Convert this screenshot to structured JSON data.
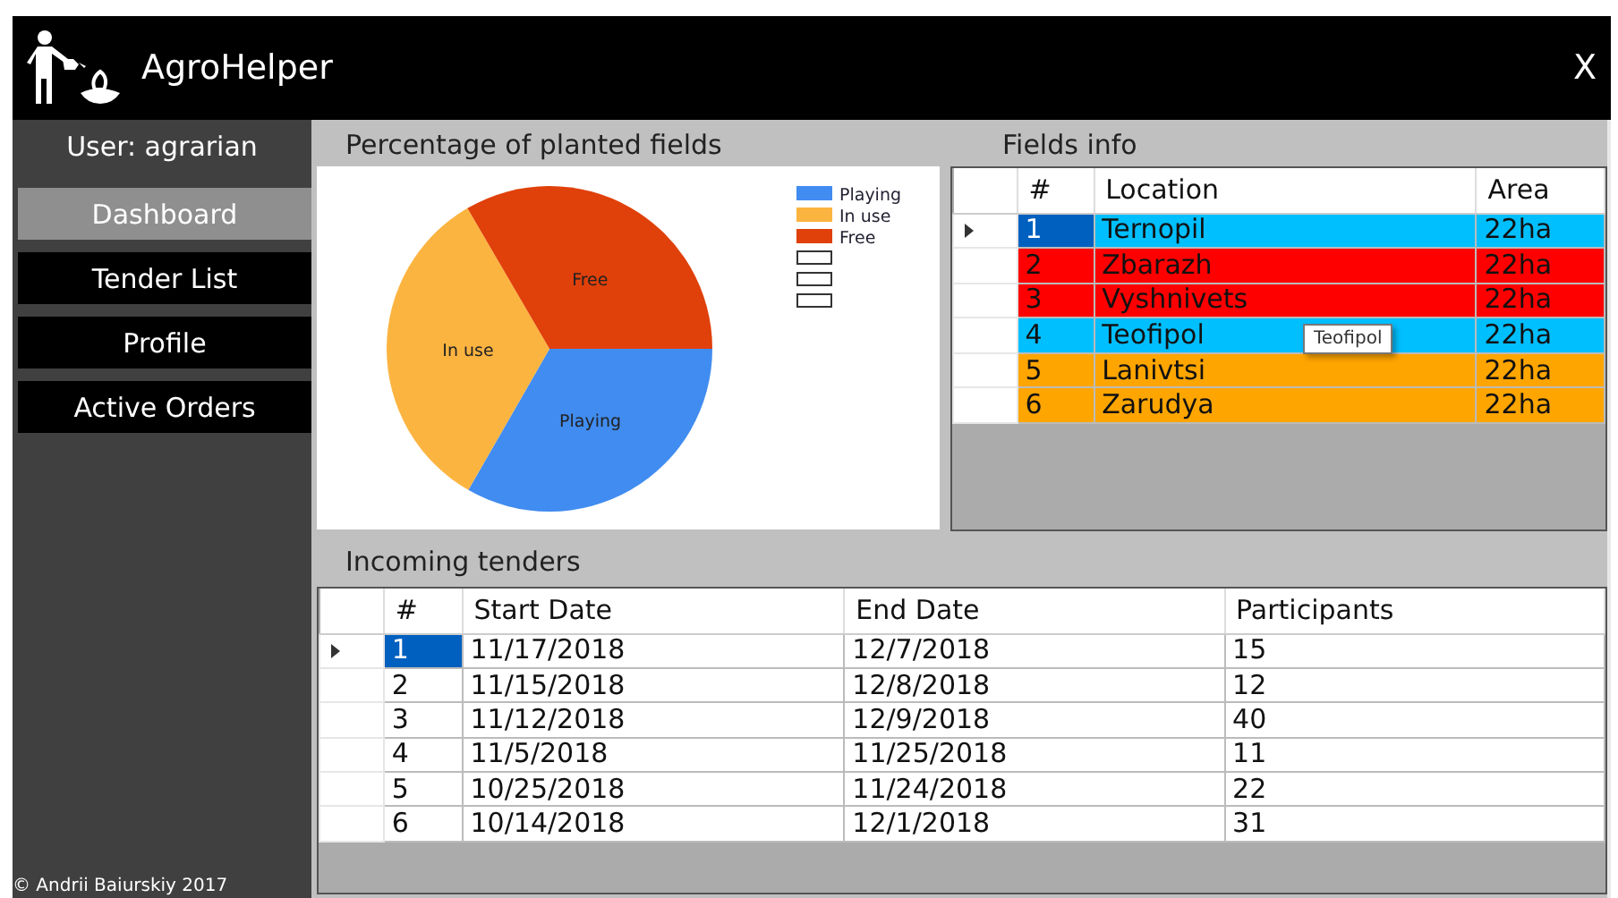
{
  "app": {
    "title": "AgroHelper",
    "close": "X"
  },
  "sidebar": {
    "user": "User: agrarian",
    "items": [
      {
        "label": "Dashboard",
        "selected": true
      },
      {
        "label": "Tender List",
        "selected": false
      },
      {
        "label": "Profile",
        "selected": false
      },
      {
        "label": "Active Orders",
        "selected": false
      }
    ],
    "footer": "© Andrii Baiurskiy 2017"
  },
  "planted_fields": {
    "title": "Percentage of planted fields",
    "chart_data": {
      "type": "pie",
      "categories": [
        "Playing",
        "In use",
        "Free"
      ],
      "values": [
        33.3,
        33.3,
        33.4
      ],
      "legend": "top-right",
      "colors": [
        "#418cf0",
        "#fcb441",
        "#e0400a"
      ]
    },
    "blank_legend_entries": [
      {
        "kind": "blank"
      },
      {
        "kind": "blank"
      },
      {
        "kind": "blank"
      }
    ]
  },
  "fields_info": {
    "title": "Fields info",
    "columns": [
      "#",
      "Location",
      "Area"
    ],
    "rows": [
      {
        "cells": [
          "1",
          "Ternopil",
          "22ha"
        ],
        "color": "#00bfff",
        "selected": true
      },
      {
        "cells": [
          "2",
          "Zbarazh",
          "22ha"
        ],
        "color": "#ff0000",
        "selected": false
      },
      {
        "cells": [
          "3",
          "Vyshnivets",
          "22ha"
        ],
        "color": "#ff0000",
        "selected": false
      },
      {
        "cells": [
          "4",
          "Teofipol",
          "22ha"
        ],
        "color": "#00bfff",
        "selected": false
      },
      {
        "cells": [
          "5",
          "Lanivtsi",
          "22ha"
        ],
        "color": "#ffa500",
        "selected": false
      },
      {
        "cells": [
          "6",
          "Zarudya",
          "22ha"
        ],
        "color": "#ffa500",
        "selected": false
      }
    ],
    "tooltip": "Teofipol"
  },
  "incoming_tenders": {
    "title": "Incoming tenders",
    "columns": [
      "#",
      "Start Date",
      "End Date",
      "Participants"
    ],
    "rows": [
      {
        "cells": [
          "1",
          "11/17/2018",
          "12/7/2018",
          "15"
        ],
        "selected": true
      },
      {
        "cells": [
          "2",
          "11/15/2018",
          "12/8/2018",
          "12"
        ],
        "selected": false
      },
      {
        "cells": [
          "3",
          "11/12/2018",
          "12/9/2018",
          "40"
        ],
        "selected": false
      },
      {
        "cells": [
          "4",
          "11/5/2018",
          "11/25/2018",
          "11"
        ],
        "selected": false
      },
      {
        "cells": [
          "5",
          "10/25/2018",
          "11/24/2018",
          "22"
        ],
        "selected": false
      },
      {
        "cells": [
          "6",
          "10/14/2018",
          "12/1/2018",
          "31"
        ],
        "selected": false
      }
    ]
  }
}
